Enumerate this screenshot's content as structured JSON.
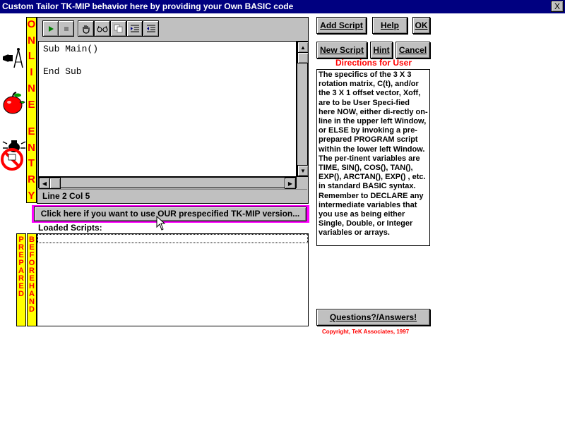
{
  "window": {
    "title": "Custom Tailor TK-MIP behavior here by providing your Own BASIC code",
    "close_label": "X"
  },
  "sidebar_icons": [
    "telescope-compass-icon",
    "apple-worm-icon",
    "no-bug-icon"
  ],
  "online_strip": [
    "O",
    "N",
    "L",
    "I",
    "N",
    "E",
    "",
    "E",
    "N",
    "T",
    "R",
    "Y"
  ],
  "prepared_strip": [
    "P",
    "R",
    "E",
    "P",
    "A",
    "R",
    "E",
    "D"
  ],
  "beforehand_strip": [
    "B",
    "E",
    "F",
    "O",
    "R",
    "E",
    "H",
    "A",
    "N",
    "D"
  ],
  "toolbar": {
    "buttons": [
      "run-icon",
      "stop-icon",
      "hand-icon",
      "glasses-icon",
      "copy-icon",
      "indent-icon",
      "outdent-icon"
    ]
  },
  "editor": {
    "code": "Sub Main()\n\nEnd Sub",
    "status": "Line 2 Col 5"
  },
  "prespecified_button": "Click here if you want to use OUR prespecified TK-MIP version...",
  "loaded_scripts_label": "Loaded Scripts:",
  "buttons": {
    "add_script": "Add Script",
    "help": "Help",
    "ok": "OK",
    "new_script": "New Script",
    "hint": "Hint",
    "cancel": "Cancel",
    "qa": "Questions?/Answers!"
  },
  "directions": {
    "title": "Directions for User",
    "text": "The specifics of the 3 X 3 rotation matrix, C(t), and/or the 3 X 1 offset vector, Xoff, are to be User Speci-fied here NOW, either di-rectly on-line in the upper left Window, or ELSE by invoking a pre-prepared PROGRAM script within the lower left Window. The per-tinent variables are TIME, SIN(), COS(), TAN(), EXP(), ARCTAN(), EXP() , etc. in standard BASIC syntax. Remember to DECLARE any intermediate variables that you use as being either Single, Double, or Integer variables or arrays."
  },
  "copyright": "Copyright, TeK Associates, 1997",
  "colors": {
    "titlebar": "#000080",
    "strip_bg": "#ffff00",
    "strip_text": "#ff0000",
    "highlight_frame": "#ff00ff",
    "button_face": "#c0c0c0"
  }
}
